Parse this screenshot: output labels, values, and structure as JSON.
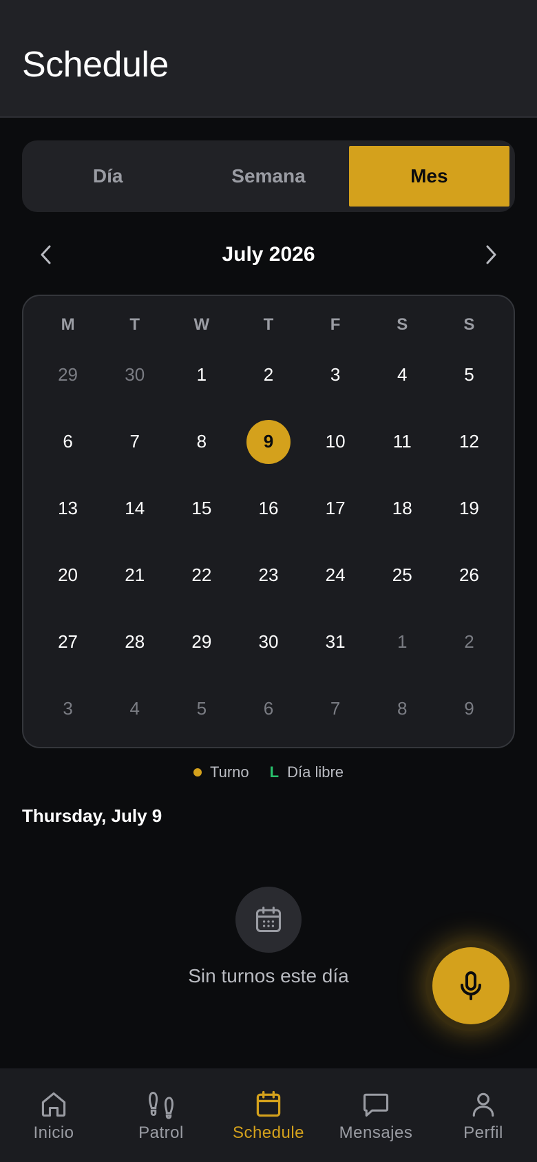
{
  "header": {
    "title": "Schedule"
  },
  "view_tabs": [
    {
      "label": "Día",
      "active": false
    },
    {
      "label": "Semana",
      "active": false
    },
    {
      "label": "Mes",
      "active": true
    }
  ],
  "calendar": {
    "month_label": "July 2026",
    "weekdays": [
      "M",
      "T",
      "W",
      "T",
      "F",
      "S",
      "S"
    ],
    "days": [
      {
        "n": "29",
        "other": true
      },
      {
        "n": "30",
        "other": true
      },
      {
        "n": "1"
      },
      {
        "n": "2"
      },
      {
        "n": "3"
      },
      {
        "n": "4"
      },
      {
        "n": "5"
      },
      {
        "n": "6"
      },
      {
        "n": "7"
      },
      {
        "n": "8"
      },
      {
        "n": "9",
        "selected": true
      },
      {
        "n": "10"
      },
      {
        "n": "11"
      },
      {
        "n": "12"
      },
      {
        "n": "13"
      },
      {
        "n": "14"
      },
      {
        "n": "15"
      },
      {
        "n": "16"
      },
      {
        "n": "17"
      },
      {
        "n": "18"
      },
      {
        "n": "19"
      },
      {
        "n": "20"
      },
      {
        "n": "21"
      },
      {
        "n": "22"
      },
      {
        "n": "23"
      },
      {
        "n": "24"
      },
      {
        "n": "25"
      },
      {
        "n": "26"
      },
      {
        "n": "27"
      },
      {
        "n": "28"
      },
      {
        "n": "29"
      },
      {
        "n": "30"
      },
      {
        "n": "31"
      },
      {
        "n": "1",
        "other": true
      },
      {
        "n": "2",
        "other": true
      },
      {
        "n": "3",
        "other": true
      },
      {
        "n": "4",
        "other": true
      },
      {
        "n": "5",
        "other": true
      },
      {
        "n": "6",
        "other": true
      },
      {
        "n": "7",
        "other": true
      },
      {
        "n": "8",
        "other": true
      },
      {
        "n": "9",
        "other": true
      }
    ]
  },
  "legend": {
    "shift_label": "Turno",
    "dayoff_marker": "L",
    "dayoff_label": "Día libre"
  },
  "selected_date_label": "Thursday, July 9",
  "empty_state": {
    "icon": "calendar-icon",
    "text": "Sin turnos este día"
  },
  "fab": {
    "icon": "microphone-icon"
  },
  "bottom_nav": [
    {
      "label": "Inicio",
      "icon": "home-icon",
      "active": false
    },
    {
      "label": "Patrol",
      "icon": "footprints-icon",
      "active": false
    },
    {
      "label": "Schedule",
      "icon": "calendar-icon",
      "active": true
    },
    {
      "label": "Mensajes",
      "icon": "message-icon",
      "active": false
    },
    {
      "label": "Perfil",
      "icon": "user-icon",
      "active": false
    }
  ],
  "colors": {
    "accent": "#d4a11c",
    "background": "#0b0c0e",
    "surface": "#1b1c20",
    "dayoff_green": "#28c26c"
  }
}
